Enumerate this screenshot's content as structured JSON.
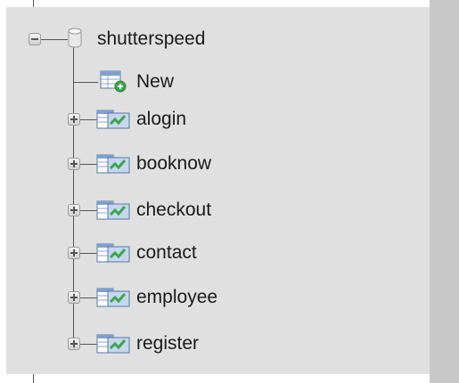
{
  "tree": {
    "database": {
      "label": "shutterspeed",
      "icon": "database-icon",
      "expanded": true
    },
    "new_item": {
      "label": "New",
      "icon": "new-table-icon"
    },
    "tables": [
      {
        "label": "alogin",
        "icon": "table-icon"
      },
      {
        "label": "booknow",
        "icon": "table-icon"
      },
      {
        "label": "checkout",
        "icon": "table-icon"
      },
      {
        "label": "contact",
        "icon": "table-icon"
      },
      {
        "label": "employee",
        "icon": "table-icon"
      },
      {
        "label": "register",
        "icon": "table-icon"
      }
    ]
  },
  "colors": {
    "panel_bg": "#e0e0e0",
    "strip_bg": "#c8c8c8",
    "text": "#1a1a1a"
  }
}
